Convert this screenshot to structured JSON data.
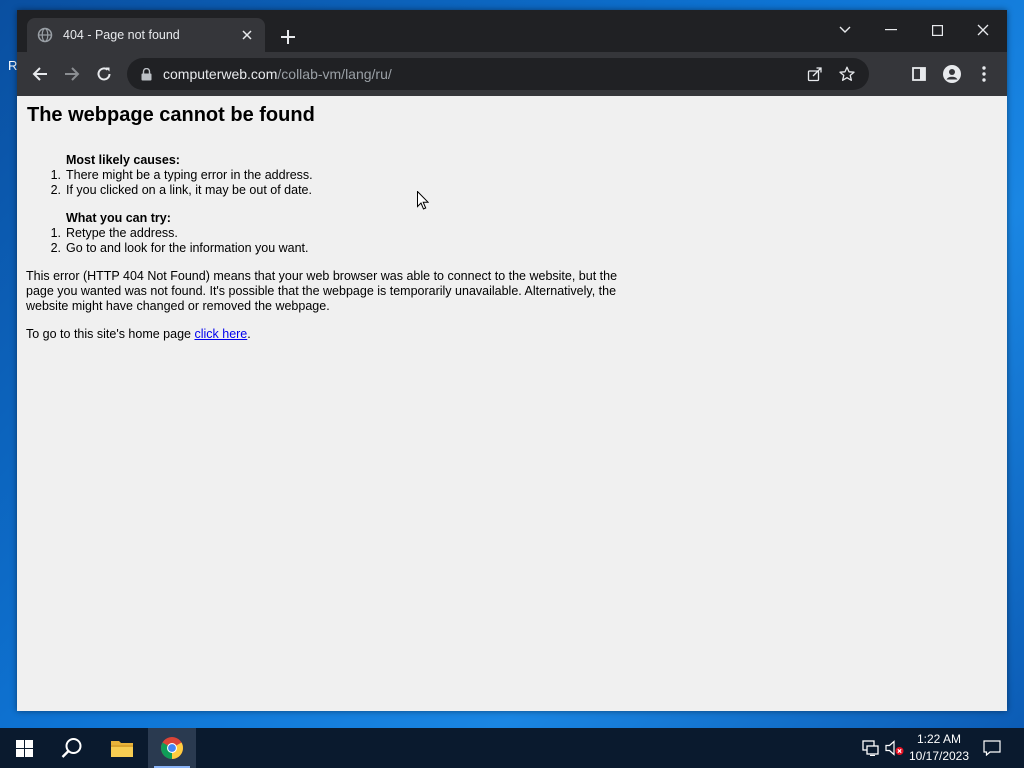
{
  "desktop": {
    "edge_fragment": "R"
  },
  "browser": {
    "tab_title": "404 - Page not found",
    "url_host": "computerweb.com",
    "url_path": "/collab-vm/lang/ru/"
  },
  "page": {
    "heading": "The webpage cannot be found",
    "causes_heading": "Most likely causes:",
    "causes": [
      "There might be a typing error in the address.",
      "If you clicked on a link, it may be out of date."
    ],
    "try_heading": "What you can try:",
    "tries": [
      "Retype the address.",
      "Go to and look for the information you want."
    ],
    "list_numbers": [
      "1.",
      "2."
    ],
    "explanation": "This error (HTTP 404 Not Found) means that your web browser was able to connect to the website, but the page you wanted was not found. It's possible that the webpage is temporarily unavailable. Alternatively, the website might have changed or removed the webpage.",
    "home_prefix": "To go to this site's home page ",
    "home_link": "click here",
    "home_suffix": "."
  },
  "taskbar": {
    "time": "1:22 AM",
    "date": "10/17/2023"
  },
  "colors": {
    "titlebar": "#202124",
    "toolbar": "#35363a",
    "page_bg": "#f0f0f0",
    "link": "#0000ee",
    "taskbar": "#0a1a2e"
  },
  "icons": {
    "tab_favicon": "globe-icon",
    "tab_close": "close-icon",
    "new_tab": "plus-icon",
    "back": "arrow-left-icon",
    "forward": "arrow-right-icon",
    "reload": "reload-icon",
    "lock": "lock-icon",
    "share": "share-icon",
    "bookmark": "star-icon",
    "side_panel": "side-panel-icon",
    "profile": "profile-icon",
    "menu": "kebab-menu-icon"
  }
}
